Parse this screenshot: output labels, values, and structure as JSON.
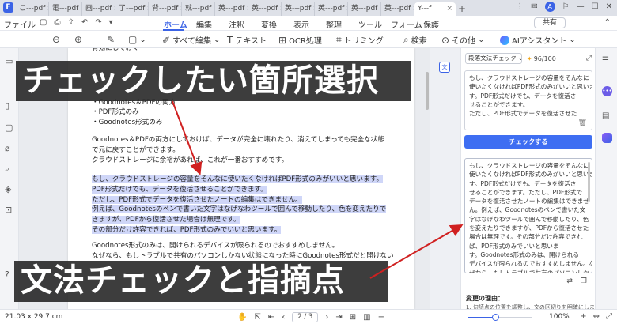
{
  "tabs": [
    {
      "label": "こ---pdf"
    },
    {
      "label": "電---pdf"
    },
    {
      "label": "画---pdf"
    },
    {
      "label": "了---pdf"
    },
    {
      "label": "背---pdf"
    },
    {
      "label": "就---pdf"
    },
    {
      "label": "英---pdf"
    },
    {
      "label": "英---pdf"
    },
    {
      "label": "英---pdf"
    },
    {
      "label": "英---pdf"
    },
    {
      "label": "英---pdf"
    },
    {
      "label": "英---pdf"
    }
  ],
  "active_tab": {
    "label": "Y---f"
  },
  "menubar": {
    "file": "ファイル",
    "items": [
      "ホーム",
      "編集",
      "注釈",
      "変換",
      "表示",
      "整理",
      "ツール",
      "フォーム",
      "保護"
    ],
    "share": "共有"
  },
  "toolbar": {
    "edit_all": "すべて編集",
    "text": "テキスト",
    "ocr": "OCR処理",
    "trim": "トリミング",
    "search": "検索",
    "other": "その他",
    "ai": "AIアシスタント"
  },
  "document": {
    "lines": [
      "有効にしておく",
      "・Goodnotes＆PDFの両方",
      "・PDF形式のみ",
      "・Goodnotes形式のみ",
      "Goodnotes＆PDFの両方にしておけば、データが完全に壊れたり、消えてしまっても完全な状態",
      "で元に戻すことができます。",
      "クラウドストレージに余裕があれば、これが一番おすすめです。"
    ],
    "highlight_lines": [
      "もし、クラウドストレージの容量をそんなに使いたくなければPDF形式のみがいいと思います。",
      "PDF形式だけでも、データを復活させることができます。",
      "ただし、PDF形式でデータを復活させたノートの編集はできません。",
      "例えば、Goodnotesのペンで書いた文字はなげなわツールで囲んで移動したり、色を変えたりで",
      "きますが、PDFから復活させた場合は無理です。",
      "その部分だけ許容できれば、PDF形式のみでいいと思います。"
    ],
    "tail_lines": [
      "Goodnotes形式のみは、開けられるデバイスが限られるのでおすすめしません。",
      "なぜなら、もしトラブルで共有のパソコンしかない状態になった時にGoodnotes形式だと開けない"
    ]
  },
  "panel": {
    "mode": "段落文法チェック",
    "credits": "96/100",
    "input_text": [
      "もし、クラウドストレージの容量をそんなに",
      "使いたくなければPDF形式のみがいいと思いま",
      "す。PDF形式だけでも、データを復活さ",
      "せることができます。",
      "ただし、PDF形式でデータを復活させた"
    ],
    "check_button": "チェックする",
    "output_text": [
      "もし、クラウドストレージの容量をそんなに",
      "使いたくなければPDF形式のみがいいと思いま",
      "す。PDF形式だけでも、データを復活さ",
      "せることができます。ただし、PDF形式で",
      "データを復活させたノートの編集はできませ",
      "ん。例えば、Goodnotesのペンで書いた文",
      "字はなげなわツールで囲んで移動したり、色",
      "を変えたりできますが、PDFから復活させた",
      "場合は無理です。その部分だけ許容できれ",
      "ば、PDF形式のみでいいと思いま",
      "す。Goodnotes形式のみは、開けられる",
      "デバイスが限られるのでおすすめしません。な",
      "ぜなら、もしトラブルで共有のパソコンしか"
    ],
    "reason_title": "変更の理由：",
    "reason_text": "1. 句読点の位置を調整し、文の区切りを明確にしました。"
  },
  "statusbar": {
    "page_size": "21.03 x 29.7 cm",
    "page_indicator": "2 / 3",
    "zoom": "100%"
  },
  "captions": {
    "top": "チェックしたい箇所選択",
    "bottom": "文法チェックと指摘点"
  },
  "colors": {
    "accent": "#3b63e6",
    "highlight": "#cfd6f8",
    "caption_bg": "#282828",
    "arrow": "#d02020"
  }
}
